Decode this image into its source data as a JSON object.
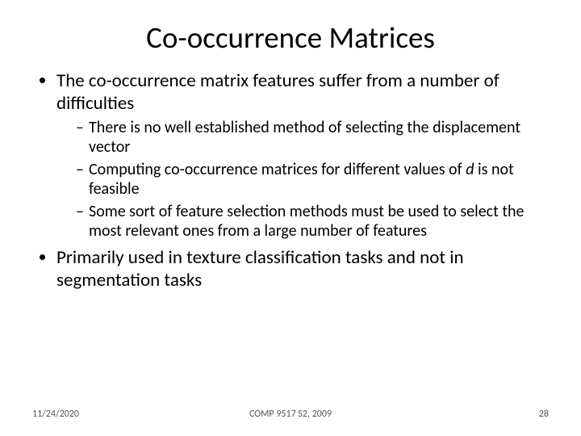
{
  "title": "Co-occurrence Matrices",
  "bullets": {
    "main1": "The co-occurrence matrix features suffer from a number of difficulties",
    "sub1": "There is no well established method of selecting the displacement vector",
    "sub2_a": "Computing co-occurrence matrices for different values of ",
    "sub2_d": "d",
    "sub2_b": " is not feasible",
    "sub3": "Some sort of feature selection methods must be used to select the most relevant ones from a large number of features",
    "main2": "Primarily used in texture classification tasks and not in segmentation tasks"
  },
  "footer": {
    "date": "11/24/2020",
    "center": "COMP 9517 S2, 2009",
    "page": "28"
  }
}
